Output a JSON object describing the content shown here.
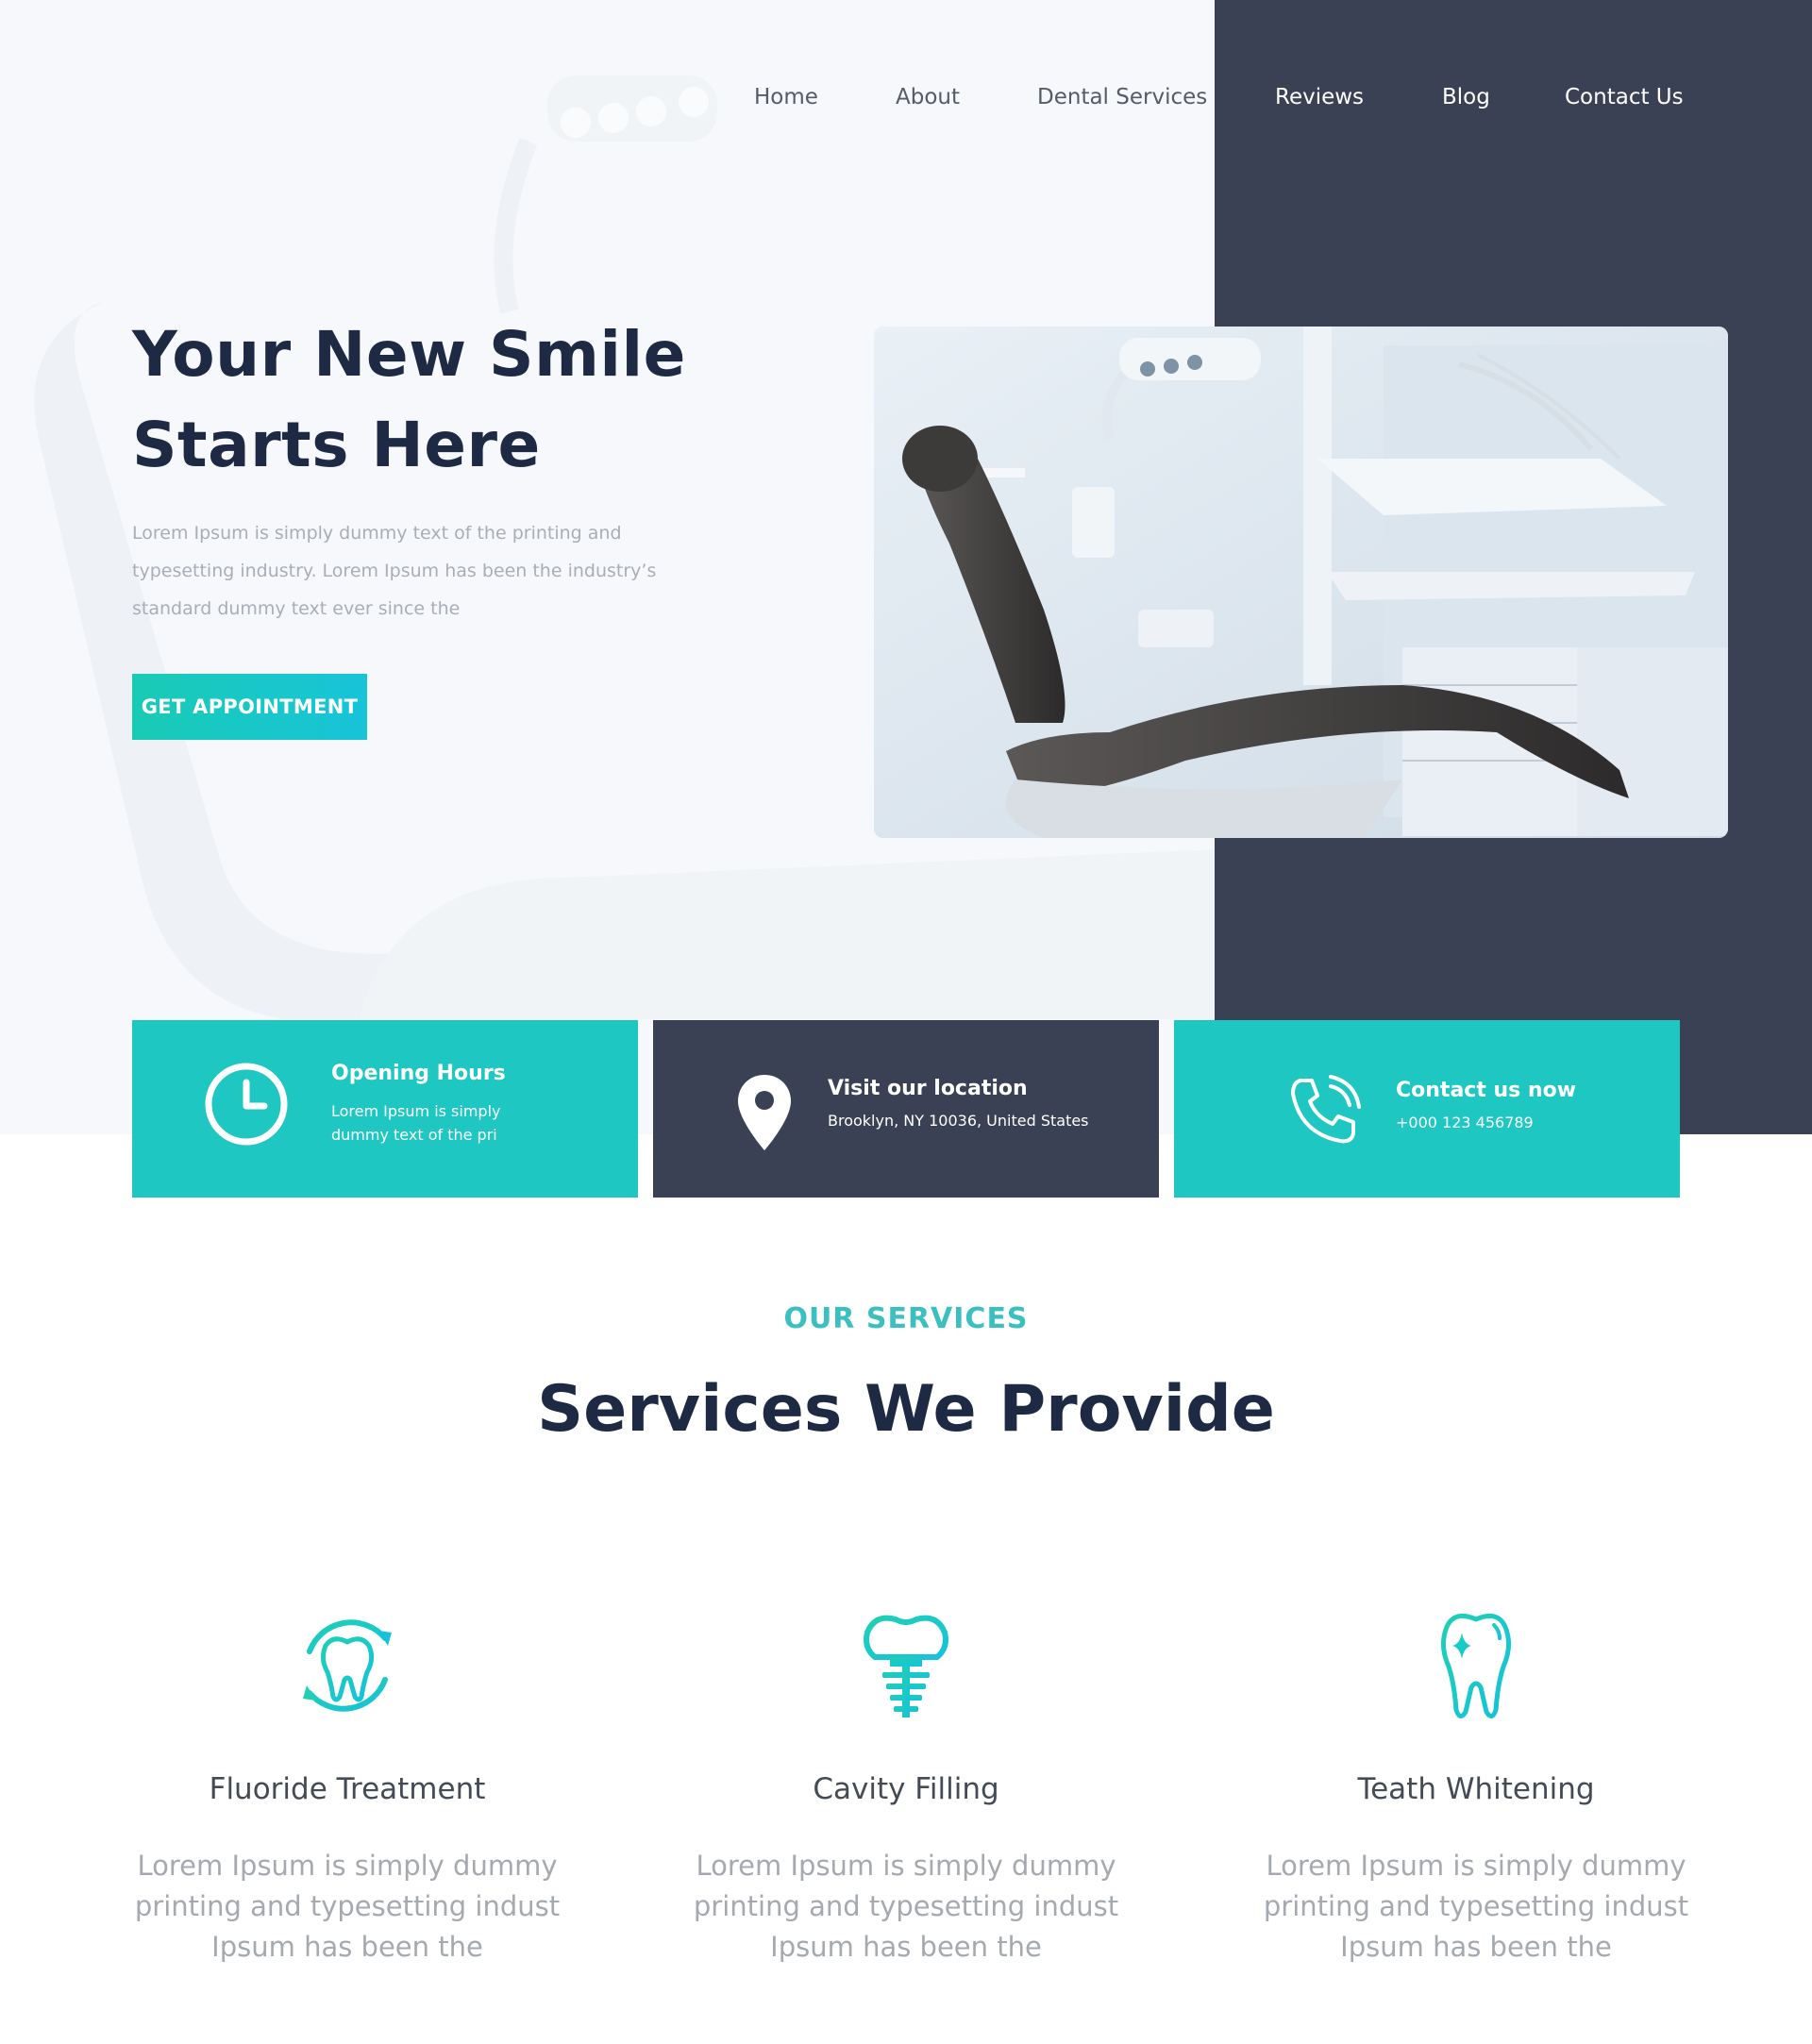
{
  "nav": {
    "items": [
      "Home",
      "About",
      "Dental Services",
      "Reviews",
      "Blog",
      "Contact Us"
    ]
  },
  "hero": {
    "title_line1": "Your New Smile",
    "title_line2": "Starts Here",
    "description": "Lorem Ipsum is simply dummy text of the printing and typesetting industry. Lorem Ipsum has been the industry’s standard dummy text ever since the",
    "cta_label": "GET APPOINTMENT"
  },
  "info_cards": [
    {
      "icon": "clock-icon",
      "title": "Opening Hours",
      "text": "Lorem Ipsum is simply dummy text of the pri"
    },
    {
      "icon": "location-pin-icon",
      "title": "Visit our location",
      "text": "Brooklyn, NY 10036, United States"
    },
    {
      "icon": "phone-icon",
      "title": "Contact us now",
      "text": "+000 123 456789"
    }
  ],
  "services": {
    "eyebrow": "OUR SERVICES",
    "heading": "Services We Provide",
    "items": [
      {
        "icon": "fluoride-tooth-icon",
        "name": "Fluoride Treatment",
        "description": "Lorem Ipsum is simply dummy printing and typesetting indust Ipsum has been the"
      },
      {
        "icon": "dental-implant-icon",
        "name": "Cavity Filling",
        "description": "Lorem Ipsum is simply dummy printing and typesetting indust Ipsum has been the"
      },
      {
        "icon": "sparkle-tooth-icon",
        "name": "Teath Whitening",
        "description": "Lorem Ipsum is simply dummy printing and typesetting indust Ipsum has been the"
      }
    ]
  },
  "colors": {
    "teal": "#1fc7c3",
    "navy": "#3a4155",
    "heading": "#1e2a44"
  }
}
